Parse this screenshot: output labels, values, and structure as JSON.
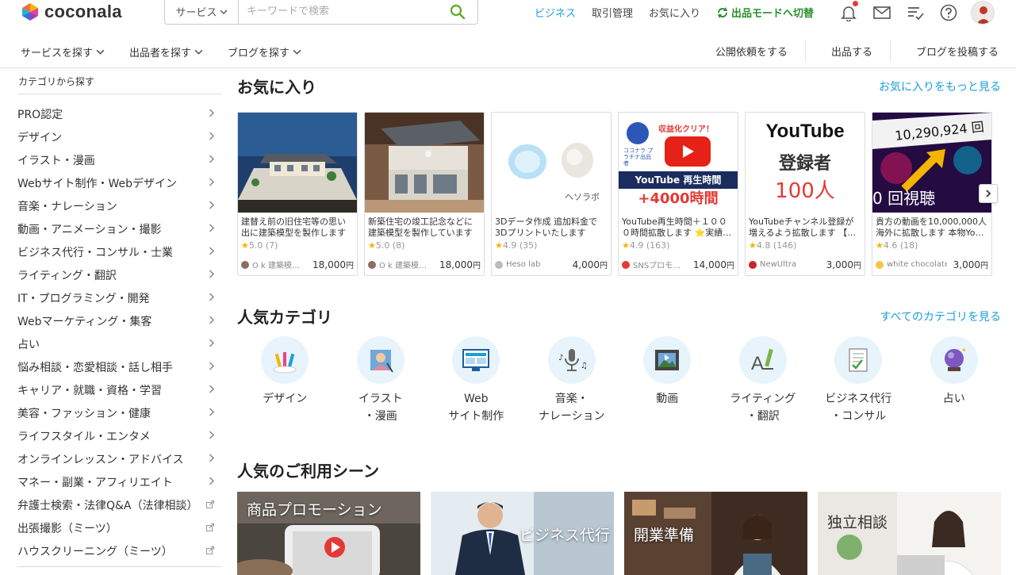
{
  "header": {
    "logo_text": "coconala",
    "search": {
      "select_label": "サービス",
      "placeholder": "キーワードで検索"
    },
    "links": {
      "business": "ビジネス",
      "transactions": "取引管理",
      "favorites": "お気に入り",
      "switch_mode": "出品モードへ切替"
    }
  },
  "subnav": {
    "left": [
      "サービスを探す",
      "出品者を探す",
      "ブログを探す"
    ],
    "right": [
      "公開依頼をする",
      "出品する",
      "ブログを投稿する"
    ]
  },
  "sidebar": {
    "title": "カテゴリから探す",
    "items": [
      {
        "label": "PRO認定",
        "external": false
      },
      {
        "label": "デザイン",
        "external": false
      },
      {
        "label": "イラスト・漫画",
        "external": false
      },
      {
        "label": "Webサイト制作・Webデザイン",
        "external": false
      },
      {
        "label": "音楽・ナレーション",
        "external": false
      },
      {
        "label": "動画・アニメーション・撮影",
        "external": false
      },
      {
        "label": "ビジネス代行・コンサル・士業",
        "external": false
      },
      {
        "label": "ライティング・翻訳",
        "external": false
      },
      {
        "label": "IT・プログラミング・開発",
        "external": false
      },
      {
        "label": "Webマーケティング・集客",
        "external": false
      },
      {
        "label": "占い",
        "external": false
      },
      {
        "label": "悩み相談・恋愛相談・話し相手",
        "external": false
      },
      {
        "label": "キャリア・就職・資格・学習",
        "external": false
      },
      {
        "label": "美容・ファッション・健康",
        "external": false
      },
      {
        "label": "ライフスタイル・エンタメ",
        "external": false
      },
      {
        "label": "オンラインレッスン・アドバイス",
        "external": false
      },
      {
        "label": "マネー・副業・アフィリエイト",
        "external": false
      },
      {
        "label": "弁護士検索・法律Q&A（法律相談）",
        "external": true
      },
      {
        "label": "出張撮影（ミーツ）",
        "external": true
      },
      {
        "label": "ハウスクリーニング（ミーツ）",
        "external": true
      }
    ]
  },
  "favorites": {
    "title": "お気に入り",
    "more": "お気に入りをもっと見る",
    "cards": [
      {
        "desc": "建替え前の旧住宅等の思い出に建築模型を製作します …",
        "rating": "5.0",
        "count": "(7)",
        "seller": "O k 建築模…",
        "price": "18,000",
        "unit": "円",
        "seller_color": "#8d6e63"
      },
      {
        "desc": "新築住宅の竣工記念などに建築模型を製作しています …",
        "rating": "5.0",
        "count": "(8)",
        "seller": "O k 建築模…",
        "price": "18,000",
        "unit": "円",
        "seller_color": "#8d6e63"
      },
      {
        "desc": "3Dデータ作成 追加料金で3Dプリントいたします 3D…",
        "rating": "4.9",
        "count": "(35)",
        "seller": "Heso lab",
        "price": "4,000",
        "unit": "円",
        "seller_color": "#bbbbbb"
      },
      {
        "desc": "YouTube再生時間＋１０００時間拡散します ⭐実績…",
        "rating": "4.9",
        "count": "(163)",
        "seller": "SNSプロモ…",
        "price": "14,000",
        "unit": "円",
        "seller_color": "#e53935"
      },
      {
        "desc": "YouTubeチャンネル登録が増えるよう拡散します 【…",
        "rating": "4.8",
        "count": "(146)",
        "seller": "NewUltra",
        "price": "3,000",
        "unit": "円",
        "seller_color": "#c62828"
      },
      {
        "desc": "貴方の動画を10,000,000人海外に拡散します 本物Yo…",
        "rating": "4.6",
        "count": "(18)",
        "seller": "white chocolate",
        "price": "3,000",
        "unit": "円",
        "seller_color": "#f5c542"
      }
    ],
    "thumb_text": {
      "c3_logo": "ヘソラボ",
      "c4_top": "収益化クリア！",
      "c4_badge": "ココナラ プラチナ出品者",
      "c4_main": "YouTube 再生時間",
      "c4_sub": "+4000時間",
      "c5_title": "YouTube",
      "c5_line1": "登録者",
      "c5_line2": "100人",
      "c6_num": "10,290,924 回",
      "c6_sub": "0 回視聴"
    }
  },
  "popular": {
    "title": "人気カテゴリ",
    "more": "すべてのカテゴリを見る",
    "items": [
      {
        "label": "デザイン"
      },
      {
        "label": "イラスト\n・漫画"
      },
      {
        "label": "Web\nサイト制作"
      },
      {
        "label": "音楽・\nナレーション"
      },
      {
        "label": "動画"
      },
      {
        "label": "ライティング\n・翻訳"
      },
      {
        "label": "ビジネス代行\n・コンサル"
      },
      {
        "label": "占い"
      }
    ]
  },
  "scenes": {
    "title": "人気のご利用シーン",
    "items": [
      {
        "label": "商品プロモーション"
      },
      {
        "label": "ビジネス代行"
      },
      {
        "label": "開業準備"
      },
      {
        "label": "独立相談"
      }
    ]
  },
  "colors": {
    "accent_blue": "#1a9dd9",
    "switch_green": "#2a8f2a",
    "star": "#f5b400"
  }
}
